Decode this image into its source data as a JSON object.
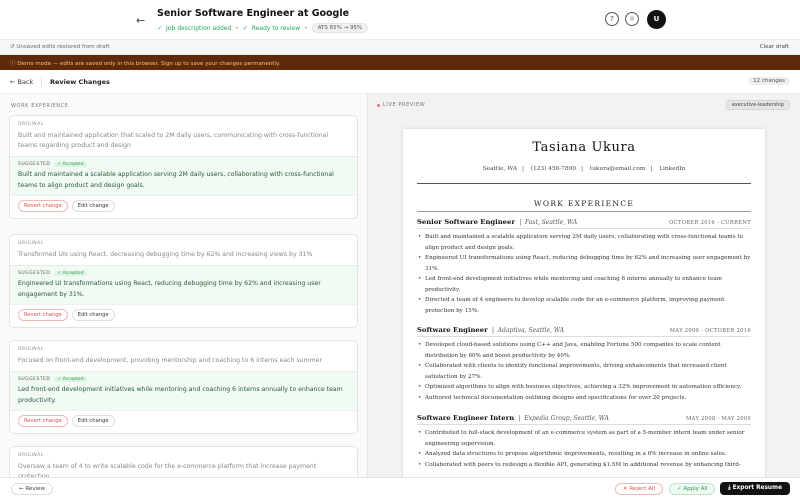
{
  "header": {
    "title": "Senior Software Engineer at Google",
    "status_1": "Job description added",
    "status_2": "Ready to review",
    "ats": "ATS 65% → 95%",
    "avatar": "U"
  },
  "draft_bar": {
    "text": "Unsaved edits restored from draft",
    "clear": "Clear draft"
  },
  "demo_bar": {
    "text": "Demo mode — edits are saved only in this browser. Sign up to save your changes permanently."
  },
  "subheader": {
    "back": "Back",
    "title": "Review Changes",
    "changes": "12 changes"
  },
  "left": {
    "section": "WORK EXPERIENCE",
    "original_label": "ORIGINAL",
    "suggested_label": "SUGGESTED",
    "accepted": "Accepted",
    "revert": "Revert change",
    "edit": "Edit change",
    "cards": [
      {
        "original": "Built and maintained application that scaled to 2M daily users, communicating with cross-functional teams regarding product and design",
        "suggested": "Built and maintained a scalable application serving 2M daily users, collaborating with cross-functional teams to align product and design goals."
      },
      {
        "original": "Transformed UIs using React, decreasing debugging time by 62% and increasing views by 31%",
        "suggested": "Engineered UI transformations using React, reducing debugging time by 62% and increasing user engagement by 31%."
      },
      {
        "original": "Focused on front-end development, providing mentorship and coaching to 6 interns each summer",
        "suggested": "Led front-end development initiatives while mentoring and coaching 6 interns annually to enhance team productivity."
      },
      {
        "original": "Oversaw a team of 4 to write scalable code for the e-commerce platform that increase payment protection"
      }
    ]
  },
  "right": {
    "live_label": "LIVE PREVIEW",
    "template": "executive-leadership"
  },
  "resume": {
    "name": "Tasiana Ukura",
    "location": "Seattle, WA",
    "phone": "(123) 456-7890",
    "email": "tukura@email.com",
    "linkedin": "LinkedIn",
    "section": "WORK EXPERIENCE",
    "jobs": [
      {
        "role": "Senior Software Engineer",
        "company": "Fast, Seattle, WA",
        "dates": "OCTOBER 2016 - CURRENT",
        "bullets": [
          "Built and maintained a scalable application serving 2M daily users, collaborating with cross-functional teams to align product and design goals.",
          "Engineered UI transformations using React, reducing debugging time by 62% and increasing user engagement by 31%.",
          "Led front-end development initiatives while mentoring and coaching 6 interns annually to enhance team productivity.",
          "Directed a team of 4 engineers to develop scalable code for an e-commerce platform, improving payment protection by 15%."
        ]
      },
      {
        "role": "Software Engineer",
        "company": "Adaptiva, Seattle, WA",
        "dates": "MAY 2009 - OCTOBER 2016",
        "bullets": [
          "Developed cloud-based solutions using C++ and Java, enabling Fortune 500 companies to scale content distribution by 60% and boost productivity by 40%.",
          "Collaborated with clients to identify functional improvements, driving enhancements that increased client satisfaction by 27%.",
          "Optimized algorithms to align with business objectives, achieving a 32% improvement in automation efficiency.",
          "Authored technical documentation outlining designs and specifications for over 20 projects."
        ]
      },
      {
        "role": "Software Engineer Intern",
        "company": "Expedia Group, Seattle, WA",
        "dates": "MAY 2008 - MAY 2009",
        "bullets": [
          "Contributed to full-stack development of an e-commerce system as part of a 5-member intern team under senior engineering supervision.",
          "Analyzed data structures to propose algorithmic improvements, resulting in a 6% increase in online sales.",
          "Collaborated with peers to redesign a flexible API, generating $1.5M in additional revenue by enhancing third-"
        ]
      }
    ]
  },
  "bottom": {
    "review": "Review",
    "reject": "Reject All",
    "apply": "Apply All",
    "export": "Export Resume"
  }
}
